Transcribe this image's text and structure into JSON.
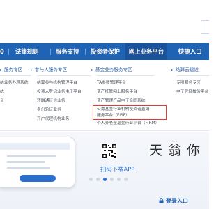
{
  "nav": {
    "items": [
      {
        "label": "法律规则"
      },
      {
        "label": "服务支持"
      },
      {
        "label": "投资者保护"
      },
      {
        "label": "网上业务平台"
      },
      {
        "label": "快捷入口"
      }
    ],
    "partial_left": "0"
  },
  "dropdown": {
    "col1": {
      "title": "服务专区",
      "links": [
        "结业务办理系统",
        "统",
        "台"
      ]
    },
    "col2": {
      "title": "参与人服务专区",
      "links": [
        "结算参与机构管理平台",
        "投资人登记业务电子平台",
        "转融通征信业务",
        "身份验证业务",
        "开户代理机构业务"
      ]
    },
    "col3": {
      "title": "基金业务服务专区",
      "links": [
        "TA参数管理平台",
        "资产托管网上服务平台",
        "资产管理产品电子合同系统"
      ],
      "highlighted": [
        "公募基金行业机构投资者直销",
        "服务平台（FISP）"
      ],
      "after": "个人养老金基金行业平台（FIRM）"
    },
    "col4": {
      "title": "结算云建设",
      "links": [
        "专项服务专区",
        "电子凭证校验平台"
      ]
    }
  },
  "banner": {
    "scan_download": "扫码下载APP",
    "brand_text": "天 翁 你"
  },
  "login": {
    "label": "登录入口"
  }
}
